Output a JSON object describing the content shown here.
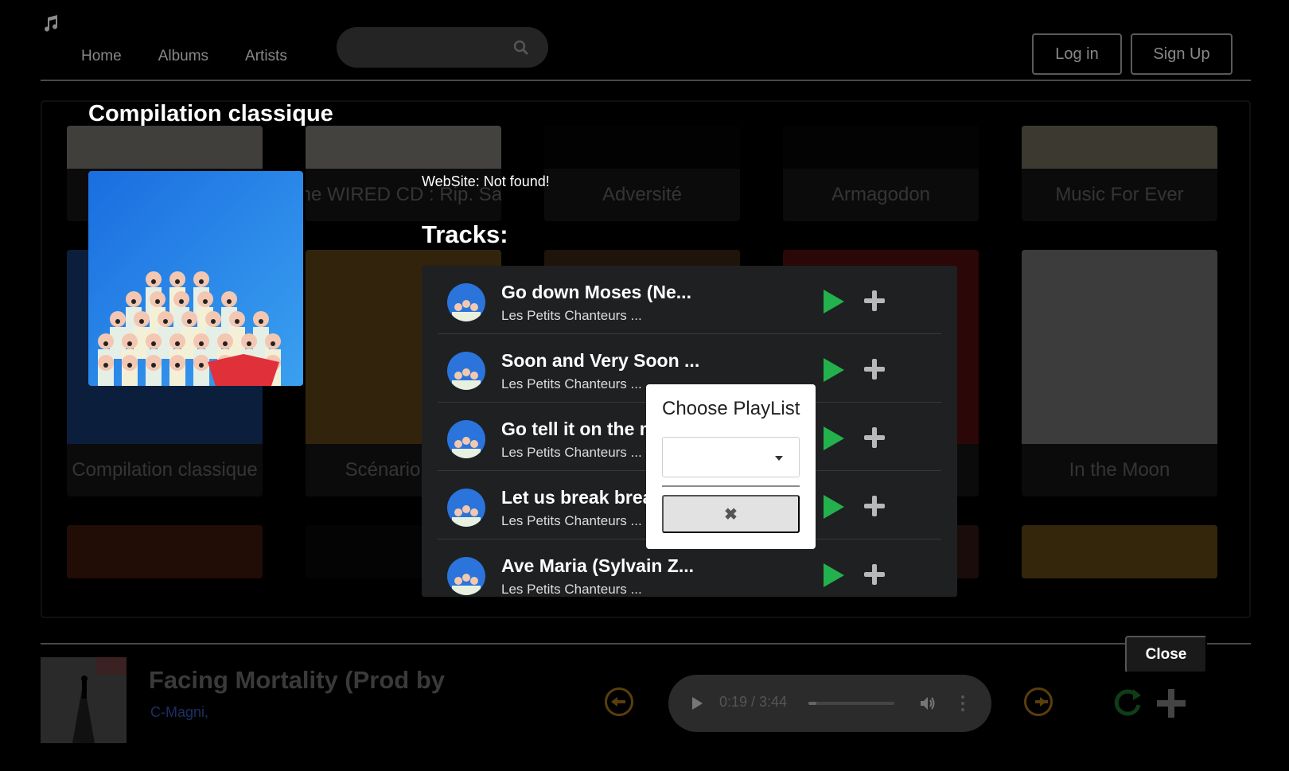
{
  "nav": {
    "items": [
      "Home",
      "Albums",
      "Artists"
    ],
    "login_label": "Log in",
    "signup_label": "Sign Up"
  },
  "search": {
    "placeholder": ""
  },
  "albums": [
    {
      "title": "",
      "art_color": "#e8e2d6"
    },
    {
      "title": "The WIRED CD : Rip. Sam",
      "art_color": "#efece2"
    },
    {
      "title": "Adversité",
      "art_color": "#0a0a0a"
    },
    {
      "title": "Armagodon",
      "art_color": "#0d0d0d"
    },
    {
      "title": "Music For Ever",
      "art_color": "#d8cbb0"
    },
    {
      "title": "Compilation classique",
      "art_color": "#2a6fd6"
    },
    {
      "title": "Scénario com",
      "art_color": "#b5812b"
    },
    {
      "title": "",
      "art_color": "#6b4a24"
    },
    {
      "title": "",
      "art_color": "#9b1a1a"
    },
    {
      "title": "In the Moon",
      "art_color": "#d8d8d8"
    },
    {
      "title": "",
      "art_color": "#7a2d18"
    },
    {
      "title": "",
      "art_color": "#101010"
    },
    {
      "title": "",
      "art_color": "#3a3028"
    },
    {
      "title": "",
      "art_color": "#5a2c24"
    },
    {
      "title": "",
      "art_color": "#b88a2a"
    }
  ],
  "album_modal": {
    "title": "Compilation classique",
    "website": "WebSite: Not found!",
    "tracks_heading": "Tracks:",
    "tracks": [
      {
        "name": "Go down Moses (Ne...",
        "artist": "Les Petits Chanteurs ..."
      },
      {
        "name": "Soon and Very Soon ...",
        "artist": "Les Petits Chanteurs ..."
      },
      {
        "name": "Go tell it on the m",
        "artist": "Les Petits Chanteurs ..."
      },
      {
        "name": "Let us break brea",
        "artist": "Les Petits Chanteurs ..."
      },
      {
        "name": "Ave Maria (Sylvain Z...",
        "artist": "Les Petits Chanteurs ..."
      }
    ]
  },
  "playlist_popup": {
    "title": "Choose PlayList",
    "selected": "",
    "close_glyph": "✖"
  },
  "player": {
    "close_label": "Close",
    "now_playing_title": "Facing Mortality (Prod by",
    "now_playing_artist": "C-Magni,",
    "time": "0:19 / 3:44",
    "progress": 0.09
  },
  "colors": {
    "play_green": "#22b14c",
    "background": "#000000"
  },
  "icons": {
    "logo": "music-note-icon",
    "search": "search-icon",
    "play": "play-icon",
    "add": "plus-icon",
    "prev": "arrow-left-circle-icon",
    "next": "arrow-right-circle-icon",
    "repeat": "repeat-icon",
    "volume": "volume-icon",
    "more": "more-vertical-icon"
  }
}
